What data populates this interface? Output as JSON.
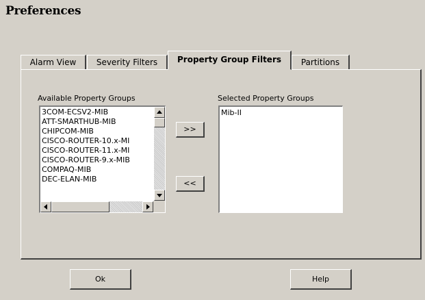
{
  "window": {
    "title": "Preferences"
  },
  "tabs": [
    {
      "label": "Alarm View",
      "active": false
    },
    {
      "label": "Severity Filters",
      "active": false
    },
    {
      "label": "Property Group Filters",
      "active": true
    },
    {
      "label": "Partitions",
      "active": false
    }
  ],
  "available": {
    "label": "Available Property Groups",
    "items": [
      "3COM-ECSV2-MIB",
      "ATT-SMARTHUB-MIB",
      "CHIPCOM-MIB",
      "CISCO-ROUTER-10.x-MI",
      "CISCO-ROUTER-11.x-MI",
      "CISCO-ROUTER-9.x-MIB",
      "COMPAQ-MIB",
      "DEC-ELAN-MIB"
    ]
  },
  "selected": {
    "label": "Selected Property Groups",
    "items": [
      "Mib-II"
    ]
  },
  "buttons": {
    "add": ">>",
    "remove": "<<",
    "ok": "Ok",
    "help": "Help"
  },
  "icons": {
    "scroll_up": "triangle-up-icon",
    "scroll_down": "triangle-down-icon",
    "scroll_left": "triangle-left-icon",
    "scroll_right": "triangle-right-icon"
  }
}
